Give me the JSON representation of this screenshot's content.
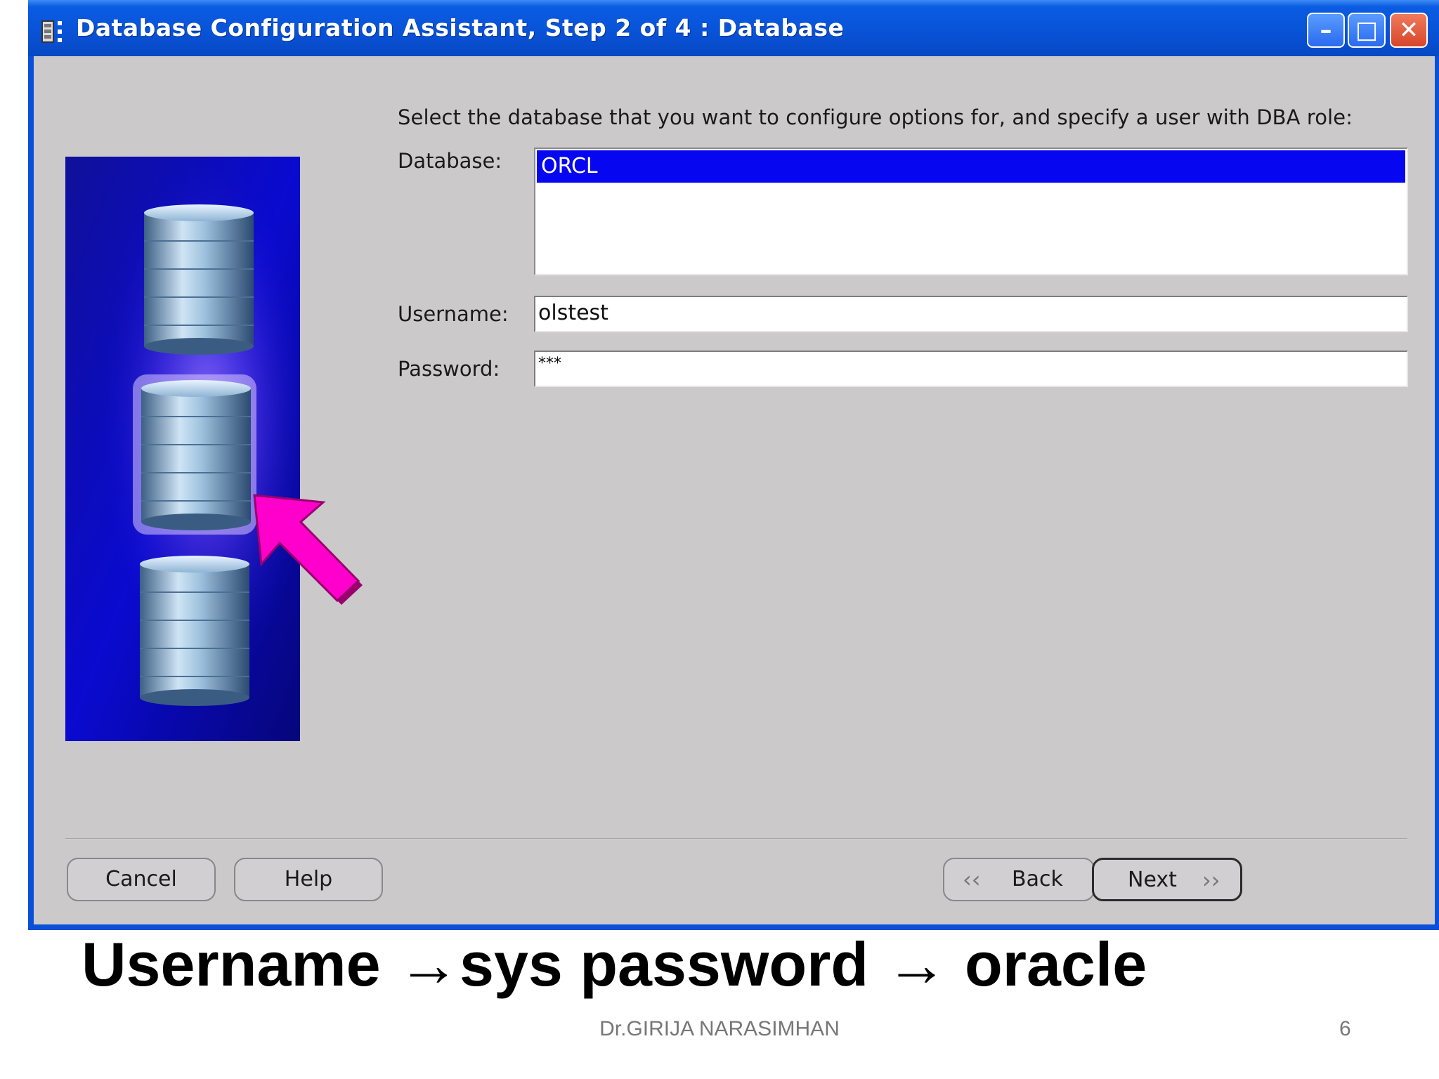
{
  "window": {
    "title": "Database Configuration Assistant, Step 2 of 4 : Database",
    "minimize_label": "–",
    "maximize_label": "□",
    "close_label": "✕"
  },
  "form": {
    "instruction": "Select the database that you want to configure options for, and specify a user with DBA role:",
    "database_label": "Database:",
    "databases": [
      "ORCL"
    ],
    "username_label": "Username:",
    "username_value": "olstest",
    "password_label": "Password:",
    "password_value": "***"
  },
  "buttons": {
    "cancel": "Cancel",
    "help": "Help",
    "back": "Back",
    "next": "Next"
  },
  "slide": {
    "caption": "Username →sys   password → oracle",
    "footer": "Dr.GIRIJA NARASIMHAN",
    "page_number": "6"
  },
  "colors": {
    "titlebar": "#0853d8",
    "client_bg": "#ccc9cb",
    "selection": "#0606f0",
    "arrow_accent": "#ff00cc"
  }
}
